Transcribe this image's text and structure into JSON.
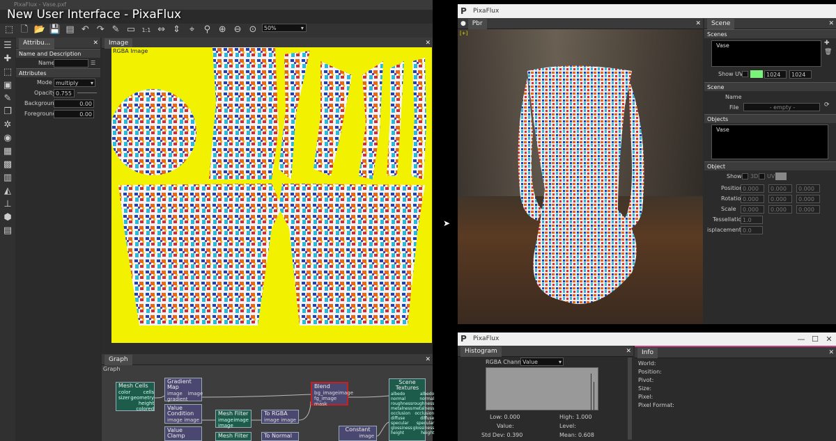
{
  "video": {
    "title": "New User Interface - PixaFlux"
  },
  "left_window": {
    "title": "PixaFlux - Vase.pxf",
    "zoom": "50%",
    "attributes": {
      "tab": "Attribu...",
      "name_section": "Name and Description",
      "name_label": "Name",
      "attributes_section": "Attributes",
      "mode_label": "Mode",
      "mode_value": "multiply",
      "opacity_label": "Opacity",
      "opacity_value": "0.755",
      "background_label": "Background",
      "background_value": "0.00",
      "foreground_label": "Foreground",
      "foreground_value": "0.00"
    },
    "image_panel": {
      "tab": "Image",
      "label": "RGBA Image"
    },
    "graph_panel": {
      "tab": "Graph",
      "label": "Graph",
      "nodes": {
        "mesh_cells": {
          "title": "Mesh Cells",
          "left": [
            "color",
            "sizer"
          ],
          "right": [
            "cells",
            "geometry",
            "height",
            "colored"
          ]
        },
        "gradient_map": {
          "title": "Gradient Map",
          "left": [
            "image",
            "gradient"
          ],
          "right": [
            "image"
          ]
        },
        "value_condition": {
          "title": "Value Condition",
          "left": [
            "image"
          ],
          "right": [
            "image"
          ]
        },
        "value_clamp": {
          "title": "Value Clamp",
          "left": [
            "image"
          ],
          "right": []
        },
        "mesh_filter_1": {
          "title": "Mesh Filter",
          "left": [
            "image",
            "image"
          ],
          "right": [
            "image"
          ]
        },
        "mesh_filter_2": {
          "title": "Mesh Filter",
          "left": [],
          "right": []
        },
        "to_rgba": {
          "title": "To RGBA",
          "left": [
            "image"
          ],
          "right": [
            "image"
          ]
        },
        "to_normal": {
          "title": "To Normal",
          "left": [],
          "right": []
        },
        "blend": {
          "title": "Blend",
          "left": [
            "bg_image",
            "fg_image",
            "mask"
          ],
          "right": [
            "image"
          ]
        },
        "constant": {
          "title": "Constant",
          "left": [],
          "right": [
            "image"
          ]
        },
        "scene_textures": {
          "title": "Scene Textures",
          "left": [
            "albedo",
            "normal",
            "roughness",
            "metalness",
            "occlusion",
            "diffuse",
            "specular",
            "glossiness",
            "height"
          ],
          "right": [
            "albedo",
            "normal",
            "roughness",
            "metalness",
            "occlusion",
            "diffuse",
            "specular",
            "glossiness",
            "height"
          ]
        }
      }
    }
  },
  "pbr_window": {
    "title": "PixaFlux",
    "pbr_tab": "Pbr",
    "scene_tab": "Scene",
    "scenes_section": "Scenes",
    "scenes_list": [
      "Vase"
    ],
    "show_uv_label": "Show UV",
    "uv_width": "1024",
    "uv_height": "1024",
    "scene_section": "Scene",
    "name_label": "Name",
    "file_label": "File",
    "file_value": "- empty -",
    "objects_section": "Objects",
    "objects_list": [
      "Vase"
    ],
    "object_section": "Object",
    "show_label": "Show",
    "show_3d": "3D",
    "show_uv": "UV",
    "position_label": "Position",
    "rotation_label": "Rotation",
    "scale_label": "Scale",
    "tessellation_label": "Tessellation",
    "tessellation_value": "1.0",
    "displacement_label": "isplacement",
    "displacement_value": "0.0",
    "zero": "0.000"
  },
  "histogram_window": {
    "title": "PixaFlux",
    "histogram_tab": "Histogram",
    "info_tab": "Info",
    "channel_label": "RGBA Channel:",
    "channel_value": "Value",
    "low_label": "Low: 0.000",
    "high_label": "High: 1.000",
    "value_label": "Value:",
    "level_label": "Level:",
    "std_label": "Std Dev: 0.390",
    "mean_label": "Mean: 0.608",
    "info_rows": [
      "World:",
      "Position:",
      "Pivot:",
      "Size:",
      "Pixel:",
      "Pixel Format:"
    ]
  },
  "colors": {
    "accent_yellow": "#f2f200",
    "node_green": "#1d5b4a",
    "node_purple": "#4a4770",
    "blend_red": "#c82020",
    "uv_swatch": "#7cf27c"
  }
}
